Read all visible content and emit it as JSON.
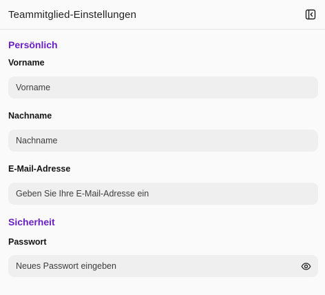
{
  "header": {
    "title": "Teammitglied-Einstellungen",
    "collapse_icon": "collapse-panel-icon"
  },
  "sections": {
    "personal": {
      "title": "Persönlich",
      "first_name": {
        "label": "Vorname",
        "placeholder": "Vorname",
        "value": ""
      },
      "last_name": {
        "label": "Nachname",
        "placeholder": "Nachname",
        "value": ""
      },
      "email": {
        "label": "E-Mail-Adresse",
        "placeholder": "Geben Sie Ihre E-Mail-Adresse ein",
        "value": ""
      }
    },
    "security": {
      "title": "Sicherheit",
      "password": {
        "label": "Passwort",
        "placeholder": "Neues Passwort eingeben",
        "value": "",
        "toggle_icon": "eye-icon"
      }
    }
  },
  "colors": {
    "accent": "#6a1fc2",
    "input_bg": "#efefef",
    "page_bg": "#fafafa",
    "divider": "#e3e3e3"
  }
}
